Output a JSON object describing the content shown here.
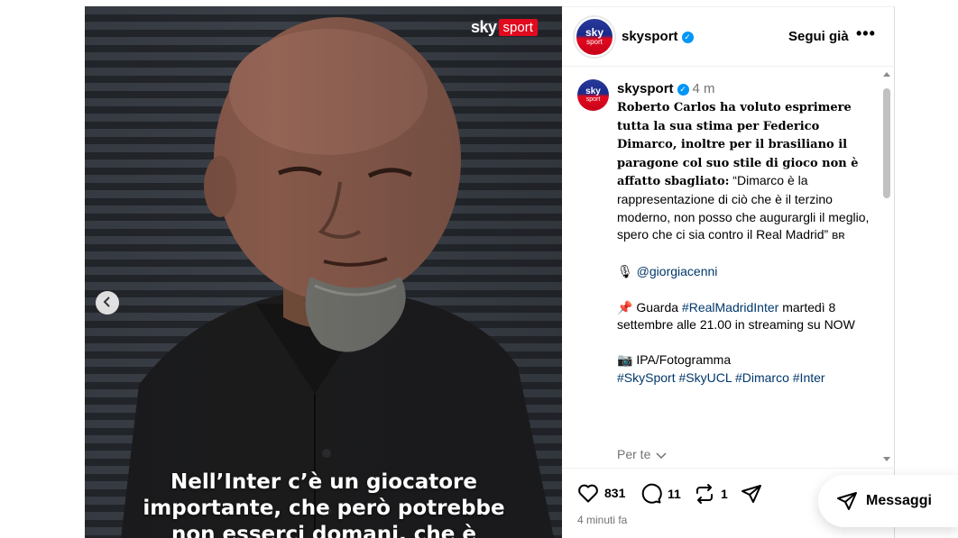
{
  "media": {
    "logo_sky": "sky",
    "logo_sport": "sport",
    "caption_lines": [
      "Nell’Inter c’è un giocatore",
      "importante, che però potrebbe",
      "non esserci domani, che è"
    ]
  },
  "header": {
    "avatar_text_top": "sky",
    "avatar_text_bottom": "sport",
    "username": "skysport",
    "follow_label": "Segui già",
    "more_label": "•••"
  },
  "post": {
    "username": "skysport",
    "time": "4 m",
    "bold_intro": "Roberto Carlos ha voluto esprimere tutta la sua stima per Federico Dimarco, inoltre per il brasiliano il paragone col suo stile di gioco non è affatto sbagliato:",
    "quote": " “Dimarco è la rappresentazione di ciò che è il terzino moderno, non posso che augurargli il meglio, spero che ci sia contro il Real Madrid” ",
    "quote_suffix": "BR",
    "mic_emoji": "🎙",
    "mention": "@giorgiacenni",
    "pin_emoji": "📌",
    "watch_prefix": " Guarda ",
    "watch_hashtag": "#RealMadridInter",
    "watch_suffix": " martedì 8 settembre alle 21.00 in streaming su NOW",
    "camera_emoji": "📷",
    "photo_credit": " IPA/Fotogramma",
    "hashtags": "#SkySport #SkyUCL #Dimarco #Inter",
    "see_translation": "Per te"
  },
  "actions": {
    "likes": "831",
    "comments": "11",
    "reposts": "1",
    "posted_ago": "4 minuti fa"
  },
  "messages": {
    "label": "Messaggi"
  },
  "colors": {
    "verified": "#0095f6",
    "sky_red": "#e10a1e",
    "link": "#00376b",
    "muted": "#737373"
  }
}
